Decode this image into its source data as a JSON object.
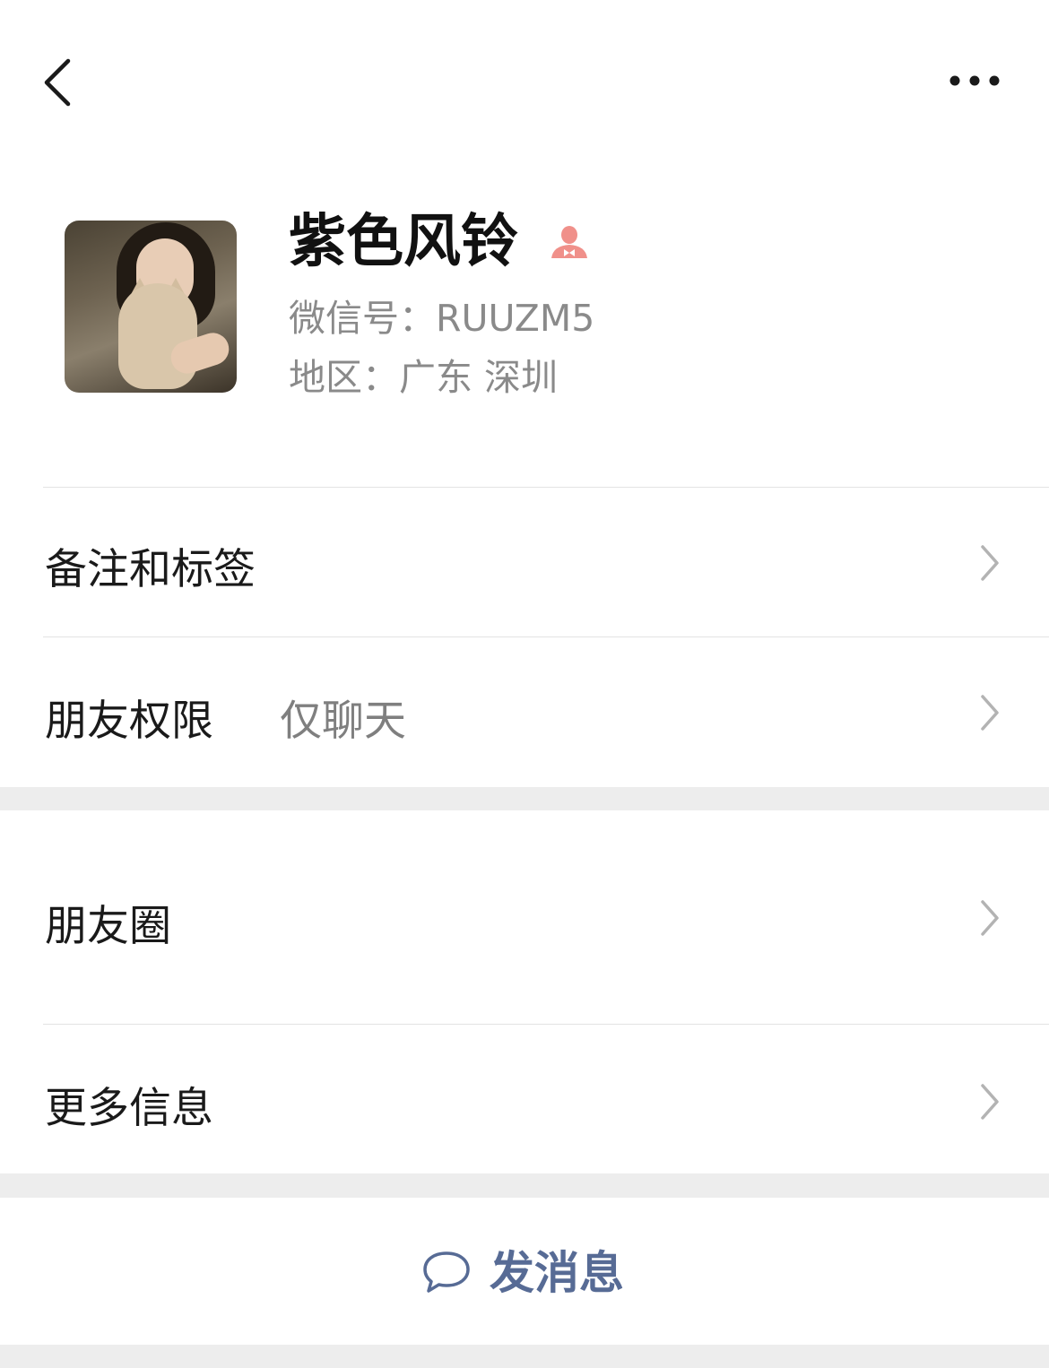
{
  "nav": {
    "back_icon": "chevron-left-icon",
    "more_icon": "ellipsis-icon"
  },
  "profile": {
    "name": "紫色风铃",
    "badge_icon": "person-badge-icon",
    "badge_color": "#f0908a",
    "wechat_id": "微信号：RUUZM5",
    "region": "地区：广东 深圳"
  },
  "rows": {
    "remarks_label": "备注和标签",
    "permissions_label": "朋友权限",
    "permissions_value": "仅聊天",
    "moments_label": "朋友圈",
    "more_info_label": "更多信息"
  },
  "actions": {
    "send_message_label": "发消息",
    "send_message_icon": "chat-bubble-icon",
    "accent_color": "#576b95"
  }
}
